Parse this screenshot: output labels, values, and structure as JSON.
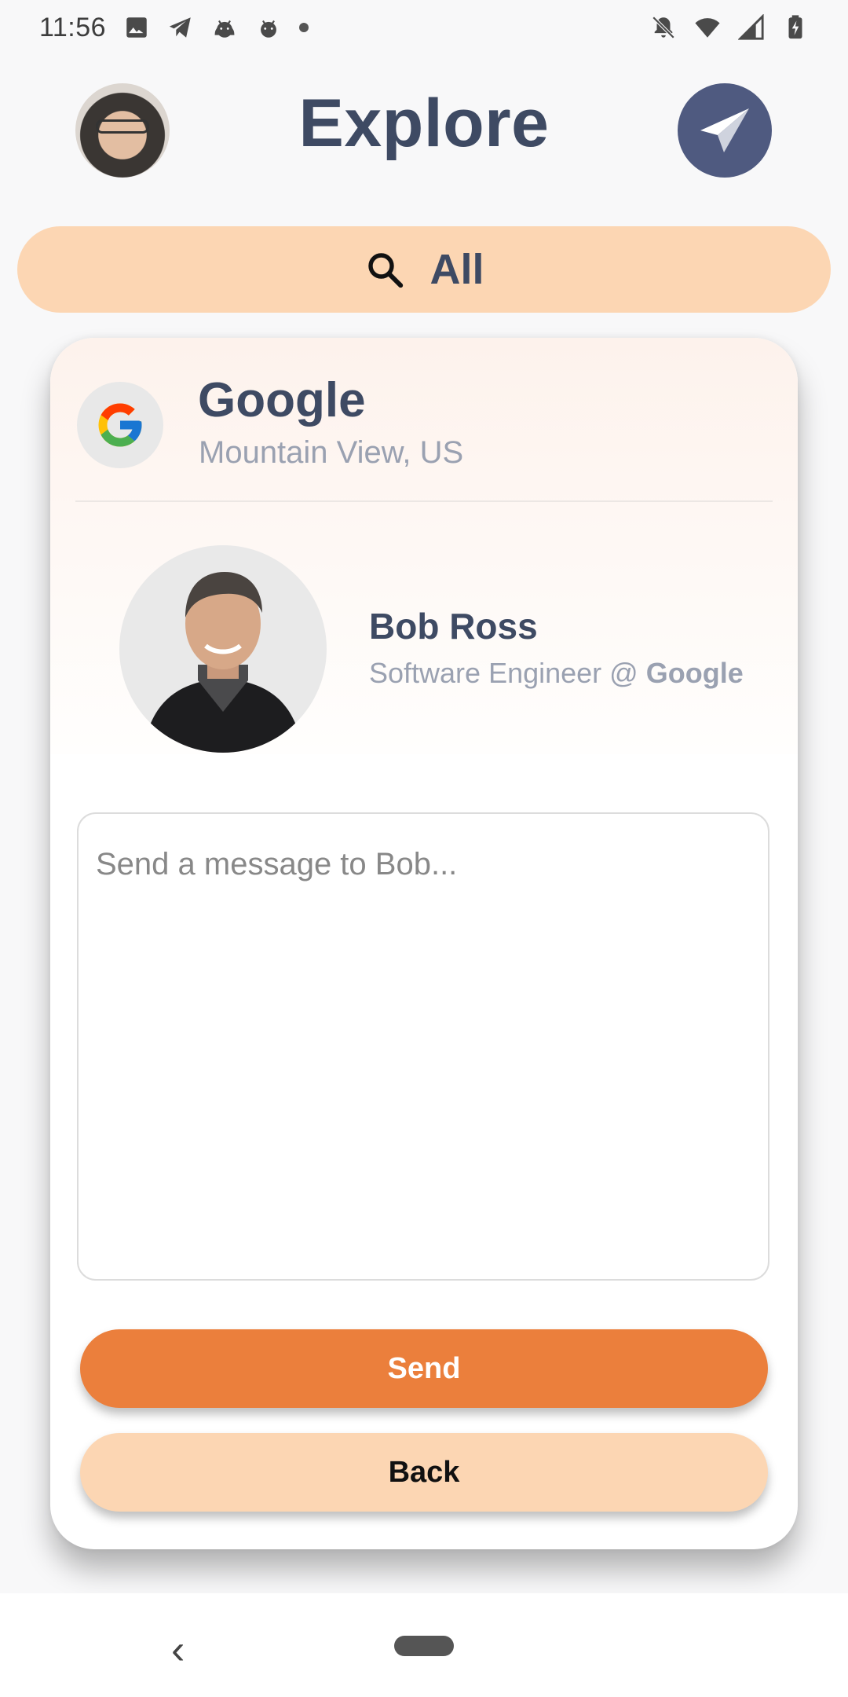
{
  "status_bar": {
    "time": "11:56",
    "left_icons": [
      "image-icon",
      "telegram-icon",
      "android-icon",
      "android-icon",
      "dot-icon"
    ],
    "right_icons": [
      "notifications-off-icon",
      "wifi-icon",
      "signal-icon",
      "battery-charging-icon"
    ]
  },
  "header": {
    "title": "Explore",
    "avatar_icon": "user-avatar",
    "action_icon": "paper-plane-icon"
  },
  "filter": {
    "icon": "search-icon",
    "label": "All"
  },
  "company": {
    "name": "Google",
    "location": "Mountain View, US",
    "logo_icon": "google-logo-icon"
  },
  "person": {
    "name": "Bob Ross",
    "role_prefix": "Software Engineer @ ",
    "role_company": "Google"
  },
  "message": {
    "placeholder": "Send a message to Bob...",
    "value": ""
  },
  "buttons": {
    "send_label": "Send",
    "back_label": "Back"
  },
  "nav": {
    "back_glyph": "‹",
    "home_icon": "home-pill-icon"
  },
  "colors": {
    "accent": "#eb7f3c",
    "accent_light": "#fcd6b3",
    "title": "#3e4a63",
    "fab": "#4f5a80",
    "muted": "#9aa1b1"
  }
}
